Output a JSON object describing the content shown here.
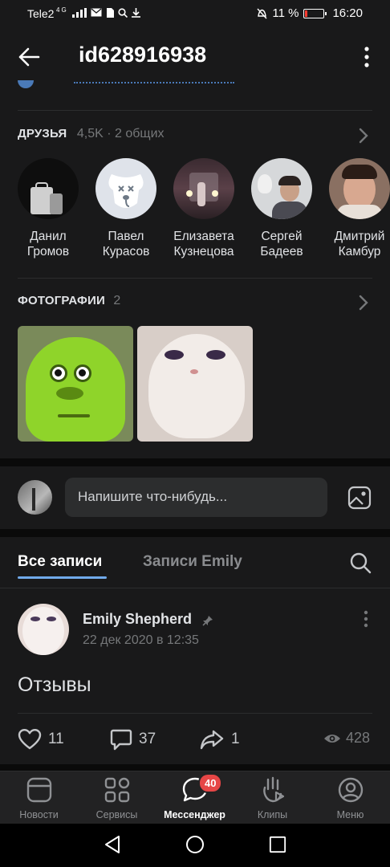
{
  "status_bar": {
    "carrier": "Tele2",
    "network_badge": "4G",
    "battery_percent": "11 %",
    "time": "16:20"
  },
  "header": {
    "title": "id628916938",
    "back_icon": "arrow-left-icon",
    "more_icon": "more-vertical-icon"
  },
  "friends": {
    "title": "ДРУЗЬЯ",
    "count": "4,5K · 2 общих",
    "items": [
      {
        "first": "Данил",
        "last": "Громов"
      },
      {
        "first": "Павел",
        "last": "Курасов"
      },
      {
        "first": "Елизавета",
        "last": "Кузнецова"
      },
      {
        "first": "Сергей",
        "last": "Бадеев"
      },
      {
        "first": "Дмитрий",
        "last": "Камбур"
      }
    ]
  },
  "photos": {
    "title": "ФОТОГРАФИИ",
    "count": "2"
  },
  "composer": {
    "placeholder": "Напишите что-нибудь..."
  },
  "wall_tabs": {
    "all": "Все записи",
    "owner": "Записи Emily"
  },
  "post": {
    "author": "Emily Shepherd",
    "date": "22 дек 2020 в 12:35",
    "text": "Отзывы",
    "likes": "11",
    "comments": "37",
    "shares": "1",
    "views": "428"
  },
  "bottom_nav": {
    "items": [
      {
        "label": "Новости",
        "icon": "news-icon"
      },
      {
        "label": "Сервисы",
        "icon": "services-icon"
      },
      {
        "label": "Мессенджер",
        "icon": "messenger-icon",
        "badge": "40"
      },
      {
        "label": "Клипы",
        "icon": "clips-icon"
      },
      {
        "label": "Меню",
        "icon": "profile-icon"
      }
    ]
  },
  "colors": {
    "background": "#19191a",
    "accent": "#71aaeb",
    "badge": "#e64646"
  }
}
